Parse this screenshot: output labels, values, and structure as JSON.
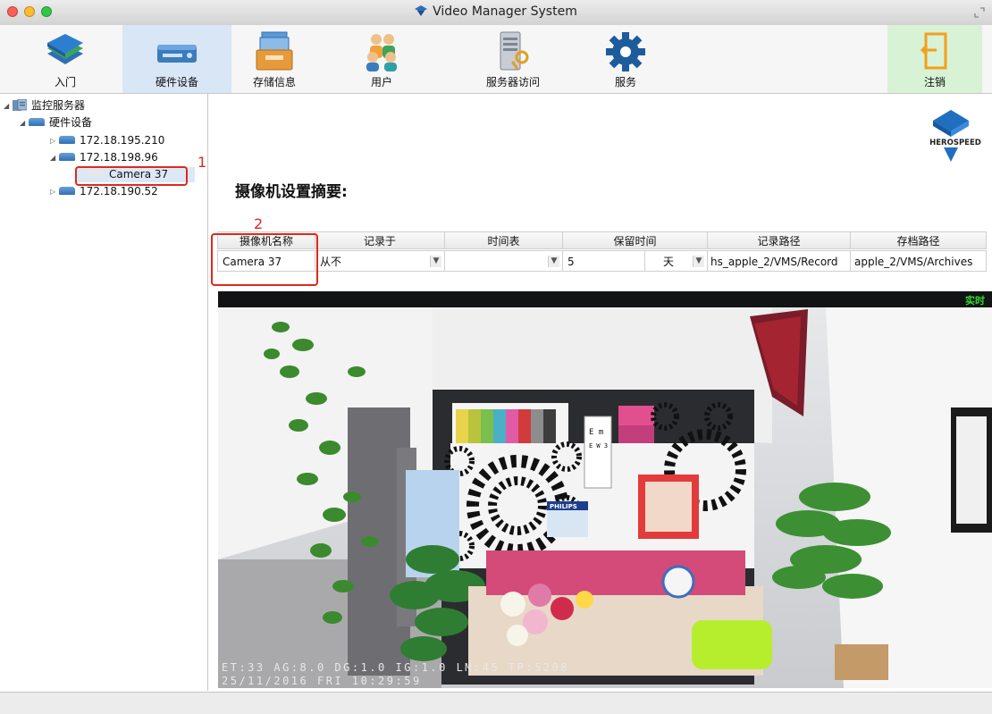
{
  "window": {
    "title": "Video Manager System"
  },
  "toolbar": {
    "items": [
      {
        "label": "入门",
        "icon": "books-icon"
      },
      {
        "label": "硬件设备",
        "icon": "hardware-device-icon"
      },
      {
        "label": "存储信息",
        "icon": "storage-tray-icon"
      },
      {
        "label": "用户",
        "icon": "users-icon"
      },
      {
        "label": "服务器访问",
        "icon": "server-key-icon"
      },
      {
        "label": "服务",
        "icon": "gear-icon"
      }
    ],
    "logout_label": "注销",
    "active_item": "硬件设备"
  },
  "tree": {
    "root": "监控服务器",
    "group": "硬件设备",
    "servers": [
      "172.18.195.210",
      "172.18.198.96",
      "172.18.190.52"
    ],
    "camera": "Camera 37",
    "selected": "Camera 37"
  },
  "logo": {
    "text": "HEROSPEED"
  },
  "main": {
    "heading": "摄像机设置摘要:"
  },
  "table": {
    "headers": [
      "摄像机名称",
      "记录于",
      "时间表",
      "保留时间",
      "记录路径",
      "存档路径"
    ],
    "row": {
      "camera_name": "Camera 37",
      "record_on": "从不",
      "schedule": "",
      "retention_value": "5",
      "retention_unit": "天",
      "record_path": "hs_apple_2/VMS/Record",
      "archive_path": "apple_2/VMS/Archives"
    }
  },
  "video": {
    "live_label": "实时",
    "osd_line1": "ET:33 AG:8.0 DG:1.0 IG:1.0 LM:45 TP:5208",
    "osd_line2": "25/11/2016 FRI 10:29:59",
    "banner_text": "PHILIPS"
  },
  "annotations": {
    "step1": "1",
    "step2": "2",
    "color": "#e0281c"
  },
  "colors": {
    "active_tab": "#d9e6f5",
    "logout_tab": "#d8f2d5",
    "osd_live": "#2ddc2d"
  }
}
